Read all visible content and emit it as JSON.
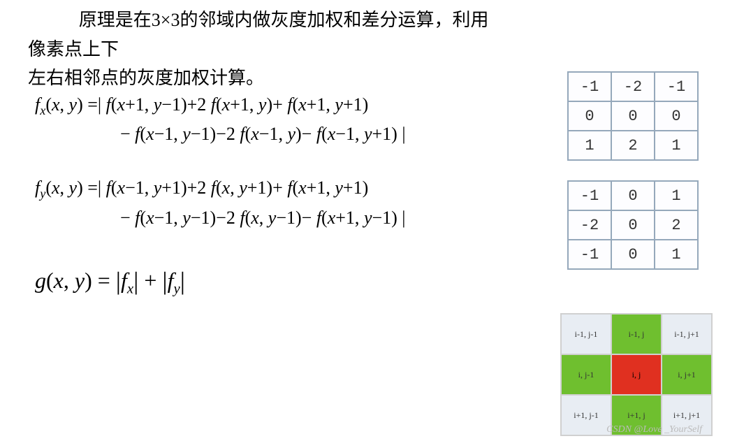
{
  "intro": {
    "line1": "原理是在3×3的邻域内做灰度加权和差分运算，利用像素点上下",
    "line2": "左右相邻点的灰度加权计算。"
  },
  "equations": {
    "fx": {
      "lhs": "f_x(x, y) =",
      "rhs1": "| f(x+1, y−1) + 2 f(x+1, y) + f(x+1, y+1)",
      "rhs2": "− f(x−1, y−1) − 2 f(x−1, y) − f(x−1, y+1) |"
    },
    "fy": {
      "lhs": "f_y(x, y) =",
      "rhs1": "| f(x−1, y+1) + 2 f(x, y+1) + f(x+1, y+1)",
      "rhs2": "− f(x−1, y−1) − 2 f(x, y−1) − f(x+1, y−1) |"
    },
    "g": "g(x, y) = |f_x| + |f_y|"
  },
  "kernels": {
    "top": [
      [
        "-1",
        "-2",
        "-1"
      ],
      [
        "0",
        "0",
        "0"
      ],
      [
        "1",
        "2",
        "1"
      ]
    ],
    "bottom": [
      [
        "-1",
        "0",
        "1"
      ],
      [
        "-2",
        "0",
        "2"
      ],
      [
        "-1",
        "0",
        "1"
      ]
    ]
  },
  "neighbor": {
    "cells": [
      [
        {
          "t": "i-1, j-1",
          "c": ""
        },
        {
          "t": "i-1, j",
          "c": "green"
        },
        {
          "t": "i-1, j+1",
          "c": ""
        }
      ],
      [
        {
          "t": "i, j-1",
          "c": "green"
        },
        {
          "t": "i, j",
          "c": "red"
        },
        {
          "t": "i, j+1",
          "c": "green"
        }
      ],
      [
        {
          "t": "i+1, j-1",
          "c": ""
        },
        {
          "t": "i+1, j",
          "c": "green"
        },
        {
          "t": "i+1, j+1",
          "c": ""
        }
      ]
    ]
  },
  "watermark": "CSDN @Love _YourSelf"
}
